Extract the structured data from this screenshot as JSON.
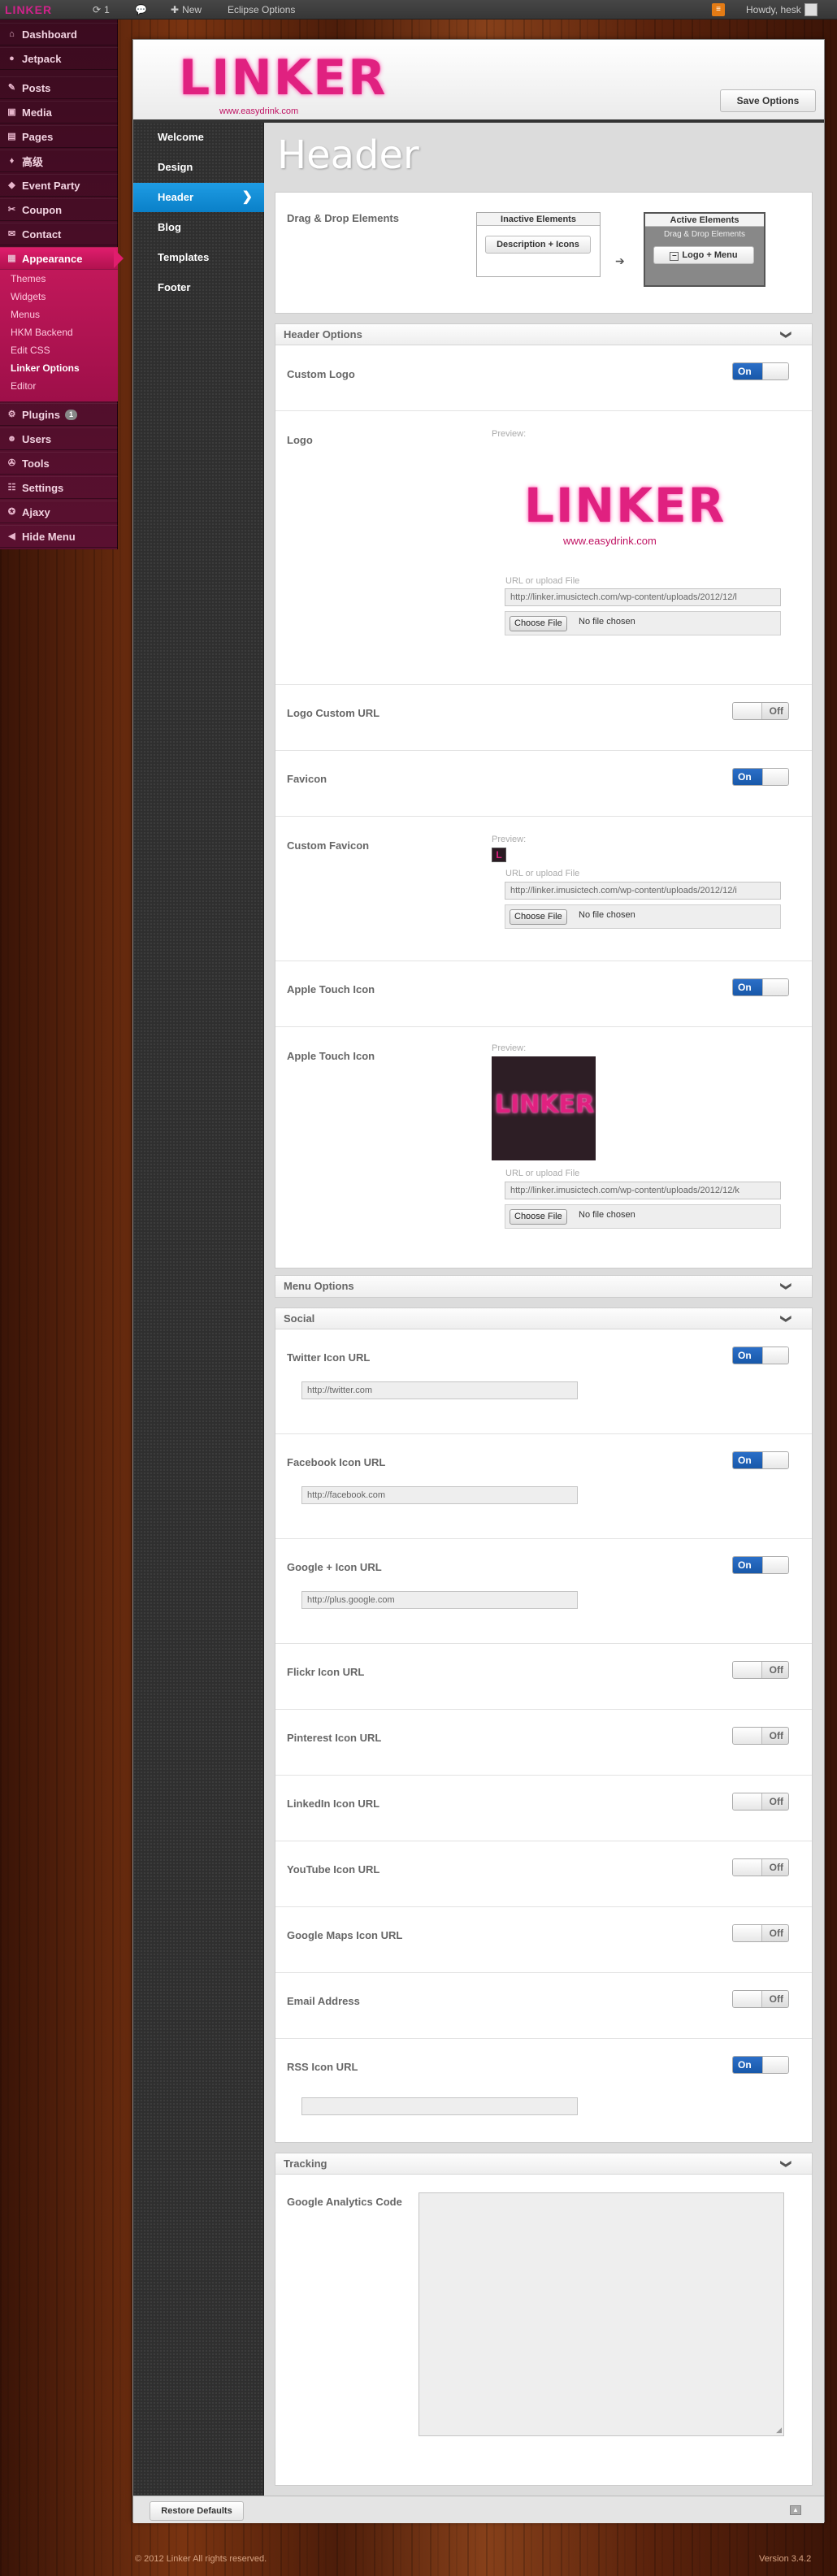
{
  "adminbar": {
    "site": "LINKER",
    "updates": "1",
    "new_label": "New",
    "eclipse": "Eclipse Options",
    "greeting": "Howdy, hesk"
  },
  "wpmenu": {
    "items": [
      {
        "label": "Dashboard",
        "icon": "dashboard-icon"
      },
      {
        "label": "Jetpack",
        "icon": "jetpack-icon"
      },
      {
        "label": "Posts",
        "icon": "pin-icon"
      },
      {
        "label": "Media",
        "icon": "media-icon"
      },
      {
        "label": "Pages",
        "icon": "pages-icon"
      },
      {
        "label": "高级",
        "icon": "drop-icon"
      },
      {
        "label": "Event Party",
        "icon": "calendar-icon"
      },
      {
        "label": "Coupon",
        "icon": "coupon-icon"
      },
      {
        "label": "Contact",
        "icon": "mail-icon"
      },
      {
        "label": "Appearance",
        "icon": "appearance-icon"
      },
      {
        "label": "Plugins",
        "icon": "plugin-icon",
        "badge": "1"
      },
      {
        "label": "Users",
        "icon": "users-icon"
      },
      {
        "label": "Tools",
        "icon": "tools-icon"
      },
      {
        "label": "Settings",
        "icon": "settings-icon"
      },
      {
        "label": "Ajaxy",
        "icon": "ajaxy-icon"
      },
      {
        "label": "Hide Menu",
        "icon": "collapse-icon"
      }
    ],
    "appearance_sub": [
      "Themes",
      "Widgets",
      "Menus",
      "HKM Backend",
      "Edit CSS",
      "Linker Options",
      "Editor"
    ]
  },
  "header": {
    "logo_text": "LINKER",
    "logo_url": "www.easydrink.com",
    "save_label": "Save Options"
  },
  "nav": [
    "Welcome",
    "Design",
    "Header",
    "Blog",
    "Templates",
    "Footer"
  ],
  "page_title": "Header",
  "dragdrop": {
    "label": "Drag & Drop Elements",
    "inactive_title": "Inactive Elements",
    "inactive_item": "Description + Icons",
    "active_title": "Active Elements",
    "active_hint": "Drag & Drop Elements",
    "active_item": "Logo + Menu"
  },
  "header_options": {
    "title": "Header Options",
    "custom_logo": "Custom Logo",
    "logo": "Logo",
    "preview": "Preview:",
    "url_upload": "URL or upload File",
    "logo_url_value": "http://linker.imusictech.com/wp-content/uploads/2012/12/l",
    "choose_file": "Choose File",
    "no_file": "No file chosen",
    "logo_custom_url": "Logo Custom URL",
    "favicon": "Favicon",
    "custom_favicon": "Custom Favicon",
    "favicon_url_value": "http://linker.imusictech.com/wp-content/uploads/2012/12/i",
    "apple_touch": "Apple Touch Icon",
    "apple_touch2": "Apple Touch Icon",
    "apple_url_value": "http://linker.imusictech.com/wp-content/uploads/2012/12/k",
    "on": "On",
    "off": "Off"
  },
  "menu_options": {
    "title": "Menu Options"
  },
  "social": {
    "title": "Social",
    "rows": [
      {
        "label": "Twitter Icon URL",
        "state": "on",
        "value": "http://twitter.com"
      },
      {
        "label": "Facebook Icon URL",
        "state": "on",
        "value": "http://facebook.com"
      },
      {
        "label": "Google + Icon URL",
        "state": "on",
        "value": "http://plus.google.com"
      },
      {
        "label": "Flickr Icon URL",
        "state": "off"
      },
      {
        "label": "Pinterest Icon URL",
        "state": "off"
      },
      {
        "label": "LinkedIn Icon URL",
        "state": "off"
      },
      {
        "label": "YouTube Icon URL",
        "state": "off"
      },
      {
        "label": "Google Maps Icon URL",
        "state": "off"
      },
      {
        "label": "Email Address",
        "state": "off"
      },
      {
        "label": "RSS Icon URL",
        "state": "on",
        "value": ""
      }
    ]
  },
  "tracking": {
    "title": "Tracking",
    "ga_label": "Google Analytics Code"
  },
  "footer": {
    "restore": "Restore Defaults",
    "copyright": "© 2012 Linker All rights reserved.",
    "version": "Version 3.4.2"
  }
}
